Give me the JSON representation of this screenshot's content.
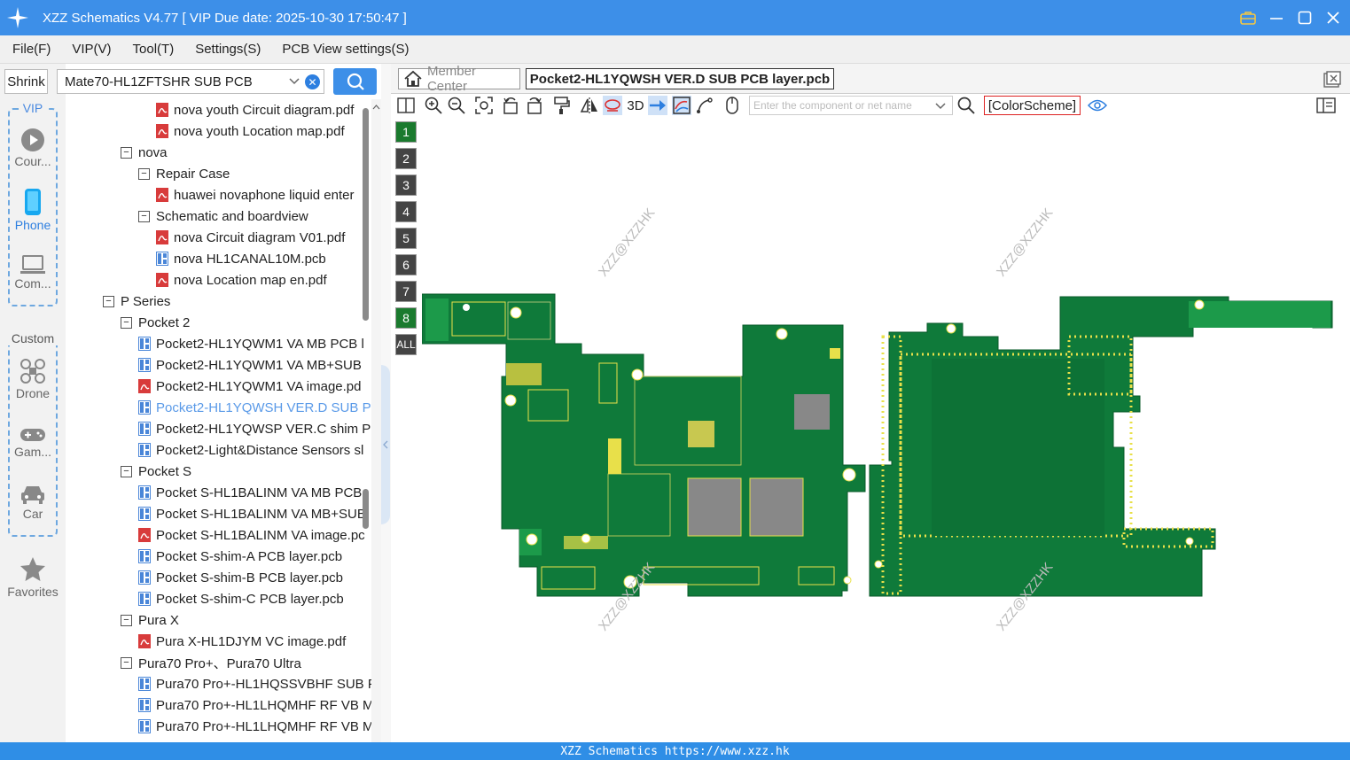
{
  "window": {
    "title": "XZZ Schematics V4.77 [ VIP Due date: 2025-10-30 17:50:47 ]"
  },
  "menu": [
    "File(F)",
    "VIP(V)",
    "Tool(T)",
    "Settings(S)",
    "PCB View settings(S)"
  ],
  "sidebar": {
    "shrink_label": "Shrink",
    "vip_label": "VIP",
    "custom_label": "Custom",
    "items": [
      {
        "label": "Cour...",
        "icon": "play-icon"
      },
      {
        "label": "Phone",
        "icon": "phone-icon"
      },
      {
        "label": "Com...",
        "icon": "laptop-icon"
      },
      {
        "label": "Drone",
        "icon": "drone-icon"
      },
      {
        "label": "Gam...",
        "icon": "gamepad-icon"
      },
      {
        "label": "Car",
        "icon": "car-icon"
      },
      {
        "label": "Favorites",
        "icon": "star-icon"
      }
    ]
  },
  "search": {
    "value": "Mate70-HL1ZFTSHR SUB PCB"
  },
  "tree": [
    {
      "label": "nova youth Circuit diagram.pdf",
      "type": "pdf",
      "level": 3
    },
    {
      "label": "nova youth Location map.pdf",
      "type": "pdf",
      "level": 3
    },
    {
      "label": "nova",
      "type": "folder",
      "level": 1
    },
    {
      "label": "Repair Case",
      "type": "folder",
      "level": 2
    },
    {
      "label": "huawei novaphone liquid enter",
      "type": "pdf",
      "level": 3
    },
    {
      "label": "Schematic and boardview",
      "type": "folder",
      "level": 2
    },
    {
      "label": "nova Circuit diagram V01.pdf",
      "type": "pdf",
      "level": 3
    },
    {
      "label": "nova HL1CANAL10M.pcb",
      "type": "pcb",
      "level": 3
    },
    {
      "label": "nova Location map en.pdf",
      "type": "pdf",
      "level": 3
    },
    {
      "label": "P Series",
      "type": "folder",
      "level": 0
    },
    {
      "label": "Pocket 2",
      "type": "folder",
      "level": 1
    },
    {
      "label": "Pocket2-HL1YQWM1 VA MB PCB l",
      "type": "pcb",
      "level": 2
    },
    {
      "label": "Pocket2-HL1YQWM1 VA MB+SUB",
      "type": "pcb",
      "level": 2
    },
    {
      "label": "Pocket2-HL1YQWM1 VA image.pd",
      "type": "pdf",
      "level": 2
    },
    {
      "label": "Pocket2-HL1YQWSH VER.D SUB P(",
      "type": "pcb",
      "level": 2,
      "selected": true
    },
    {
      "label": "Pocket2-HL1YQWSP VER.C shim P(",
      "type": "pcb",
      "level": 2
    },
    {
      "label": "Pocket2-Light&Distance Sensors sl",
      "type": "pcb",
      "level": 2
    },
    {
      "label": "Pocket S",
      "type": "folder",
      "level": 1
    },
    {
      "label": "Pocket S-HL1BALINM VA MB PCB",
      "type": "pcb",
      "level": 2
    },
    {
      "label": "Pocket S-HL1BALINM VA MB+SUB",
      "type": "pcb",
      "level": 2
    },
    {
      "label": "Pocket S-HL1BALINM VA image.pc",
      "type": "pdf",
      "level": 2
    },
    {
      "label": "Pocket S-shim-A PCB layer.pcb",
      "type": "pcb",
      "level": 2
    },
    {
      "label": "Pocket S-shim-B PCB layer.pcb",
      "type": "pcb",
      "level": 2
    },
    {
      "label": "Pocket S-shim-C PCB layer.pcb",
      "type": "pcb",
      "level": 2
    },
    {
      "label": "Pura X",
      "type": "folder",
      "level": 1
    },
    {
      "label": "Pura X-HL1DJYM VC image.pdf",
      "type": "pdf",
      "level": 2
    },
    {
      "label": "Pura70 Pro+、Pura70 Ultra",
      "type": "folder",
      "level": 1
    },
    {
      "label": "Pura70 Pro+-HL1HQSSVBHF SUB F",
      "type": "pcb",
      "level": 2
    },
    {
      "label": "Pura70 Pro+-HL1LHQMHF RF VB M",
      "type": "pcb",
      "level": 2
    },
    {
      "label": "Pura70 Pro+-HL1LHQMHF RF VB M",
      "type": "pcb",
      "level": 2
    }
  ],
  "tabs": {
    "member_center": "Member Center",
    "document": "Pocket2-HL1YQWSH VER.D SUB PCB layer.pcb"
  },
  "toolbar": {
    "three_d": "3D",
    "component_placeholder": "Enter the component or net name",
    "color_scheme": "[ColorScheme]"
  },
  "layers": [
    "1",
    "2",
    "3",
    "4",
    "5",
    "6",
    "7",
    "8",
    "ALL"
  ],
  "watermark": "XZZ@XZZHK",
  "status": "XZZ Schematics https://www.xzz.hk",
  "colors": {
    "accent": "#3d8fe8",
    "pcb_green": "#0f7a3a",
    "pcb_pad": "#e8e04a",
    "selected_text": "#5a9ae8"
  }
}
